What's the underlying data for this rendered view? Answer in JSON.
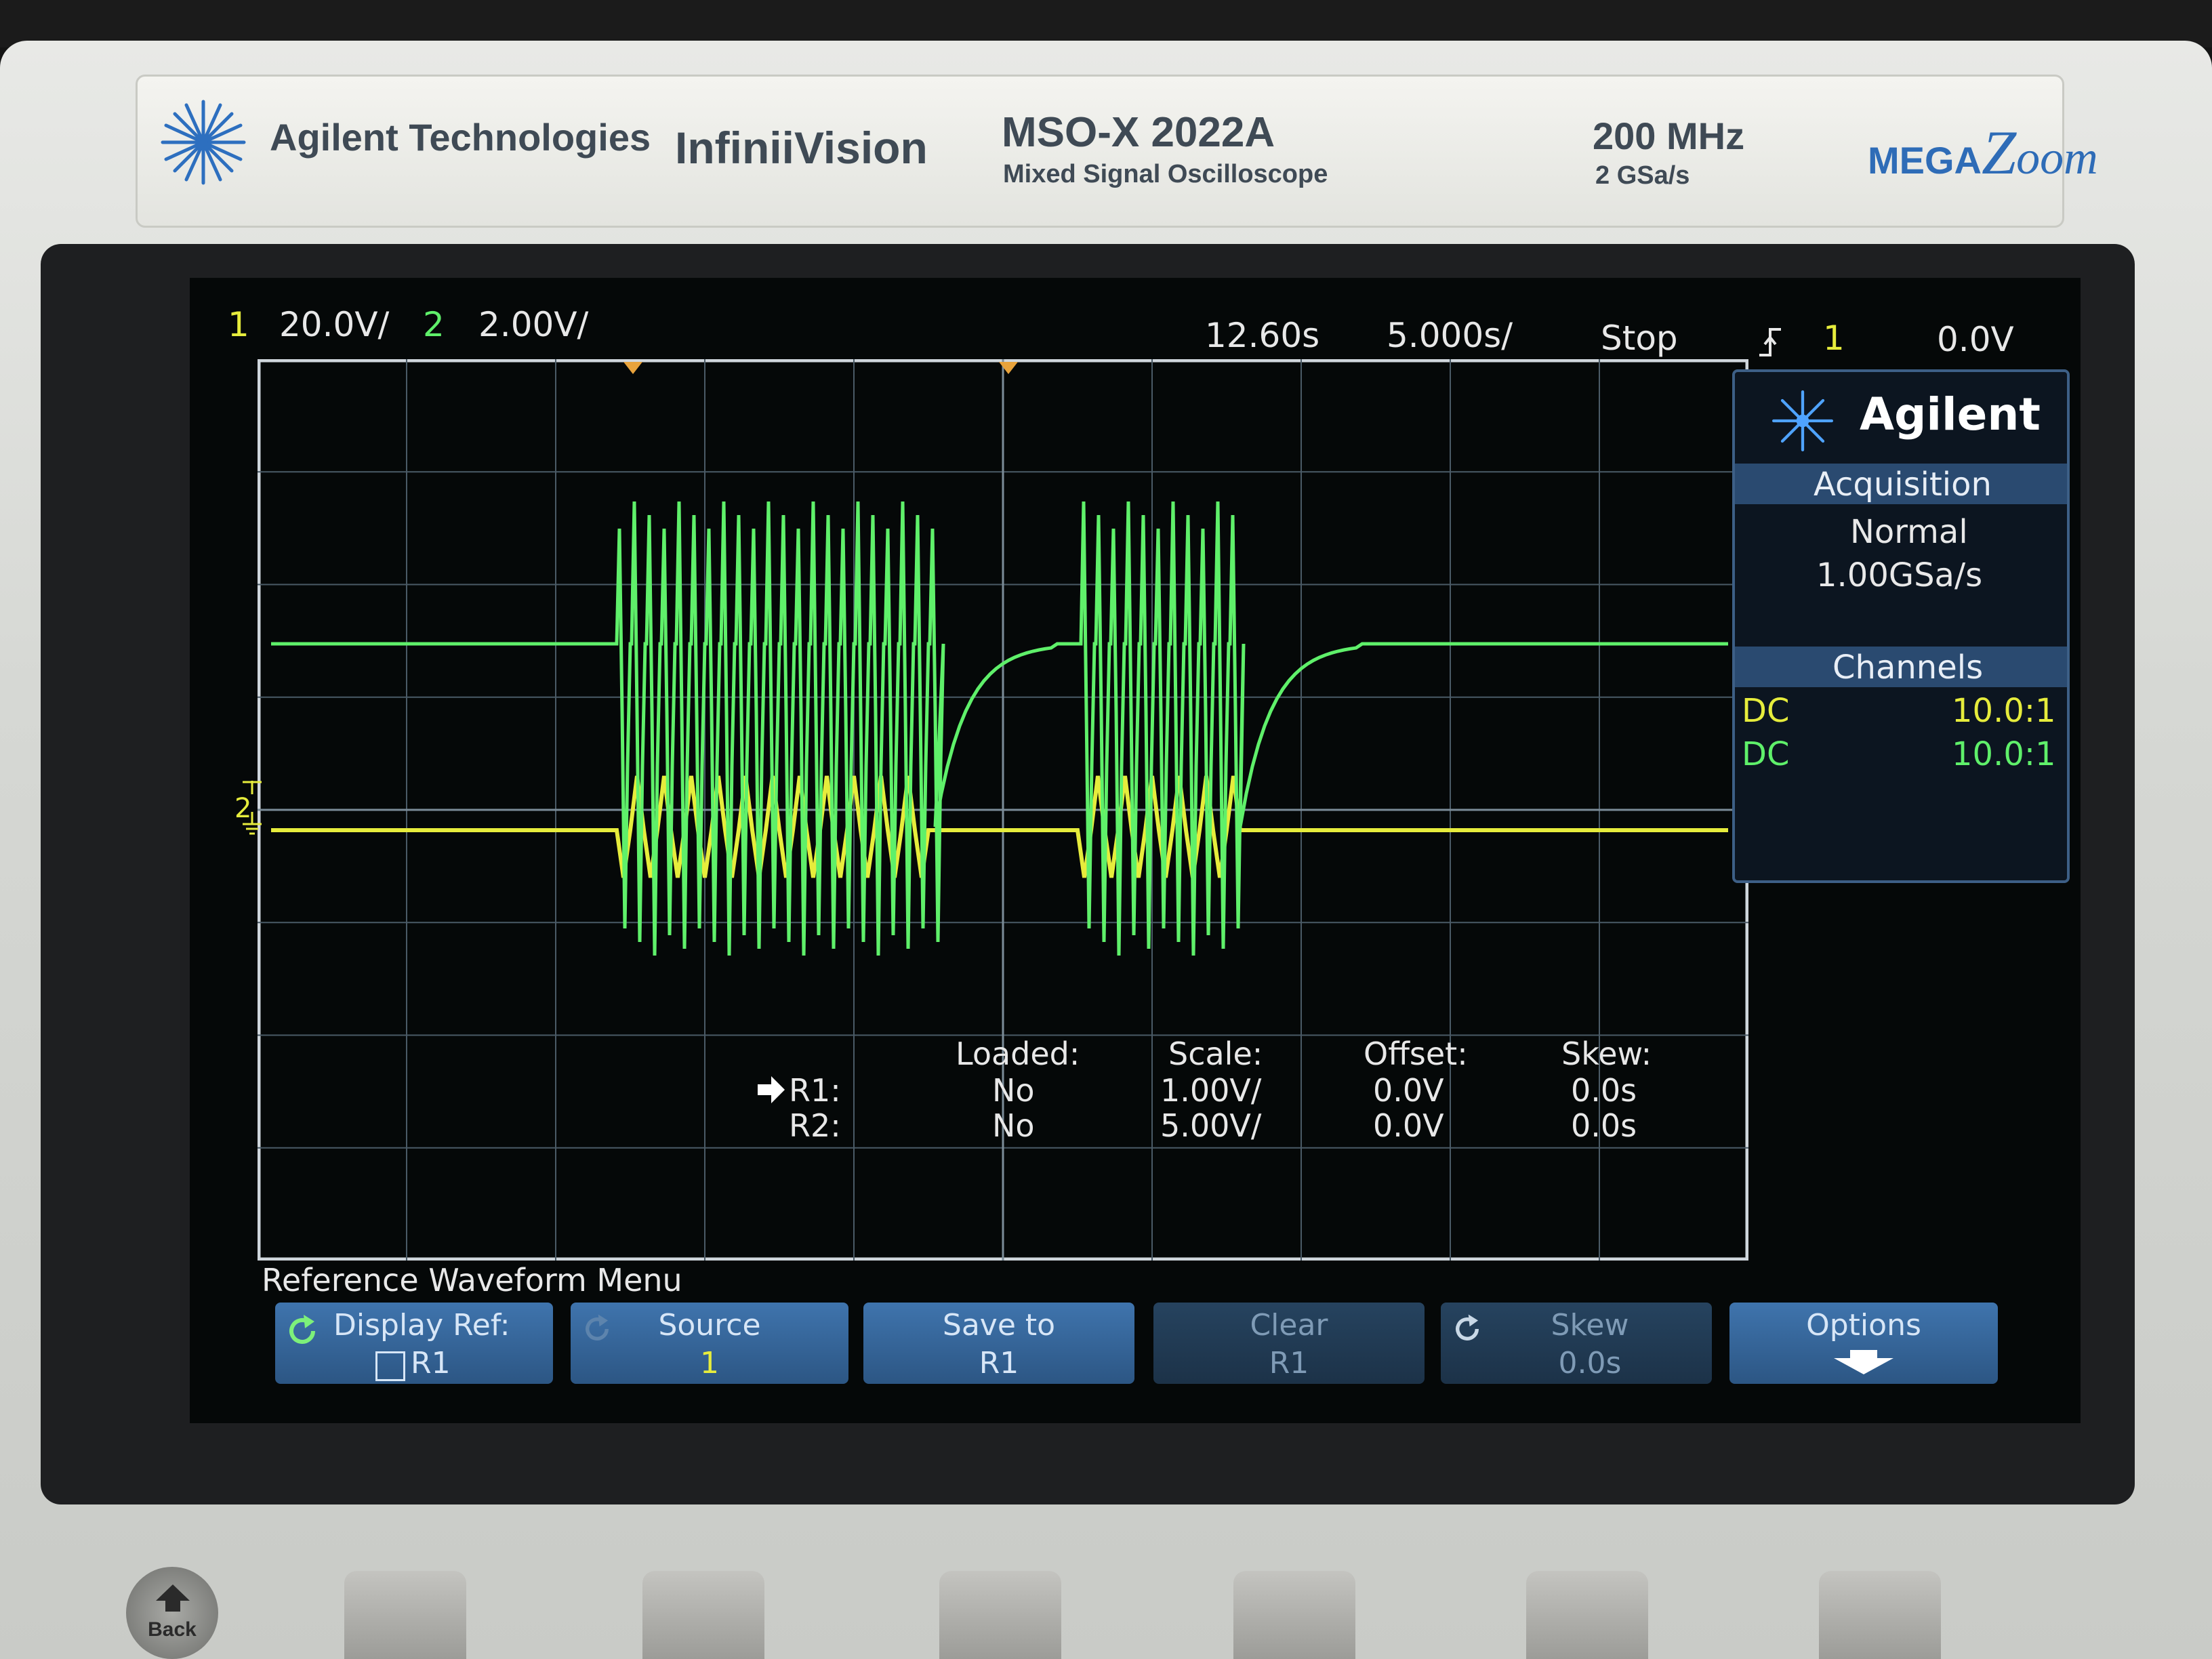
{
  "brand": {
    "company": "Agilent Technologies",
    "series": "InfiniiVision",
    "model": "MSO-X 2022A",
    "model_sub": "Mixed Signal Oscilloscope",
    "bandwidth": "200 MHz",
    "sample_rate": "2 GSa/s",
    "megazoom": "MEGA",
    "megazoom_z": "Z",
    "megazoom_rest": "oom"
  },
  "status": {
    "ch1_num": "1",
    "ch1_scale": "20.0V/",
    "ch2_num": "2",
    "ch2_scale": "2.00V/",
    "time_pos": "12.60s",
    "time_scale": "5.000s/",
    "run_state": "Stop",
    "trig_source": "1",
    "trig_level": "0.0V"
  },
  "side_panel": {
    "logo": "Agilent",
    "acq_title": "Acquisition",
    "acq_mode": "Normal",
    "acq_rate": "1.00GSa/s",
    "channels_title": "Channels",
    "channels": [
      {
        "coupling": "DC",
        "probe": "10.0:1"
      },
      {
        "coupling": "DC",
        "probe": "10.0:1"
      }
    ]
  },
  "ref_table": {
    "headers": [
      "Loaded:",
      "Scale:",
      "Offset:",
      "Skew:"
    ],
    "rows": [
      {
        "name": "R1:",
        "loaded": "No",
        "scale": "1.00V/",
        "offset": "0.0V",
        "skew": "0.0s"
      },
      {
        "name": "R2:",
        "loaded": "No",
        "scale": "5.00V/",
        "offset": "0.0V",
        "skew": "0.0s"
      }
    ]
  },
  "menu_title": "Reference Waveform Menu",
  "softkeys": [
    {
      "label": "Display Ref:",
      "value": "R1"
    },
    {
      "label": "Source",
      "value": "1"
    },
    {
      "label": "Save to",
      "value": "R1"
    },
    {
      "label": "Clear",
      "value": "R1"
    },
    {
      "label": "Skew",
      "value": "0.0s"
    },
    {
      "label": "Options",
      "value": ""
    }
  ],
  "back_button": "Back",
  "colors": {
    "ch1": "#e6ec3c",
    "ch2": "#5ff06a",
    "panel_blue": "#3d6fa6",
    "grid": "#4a5a66"
  }
}
